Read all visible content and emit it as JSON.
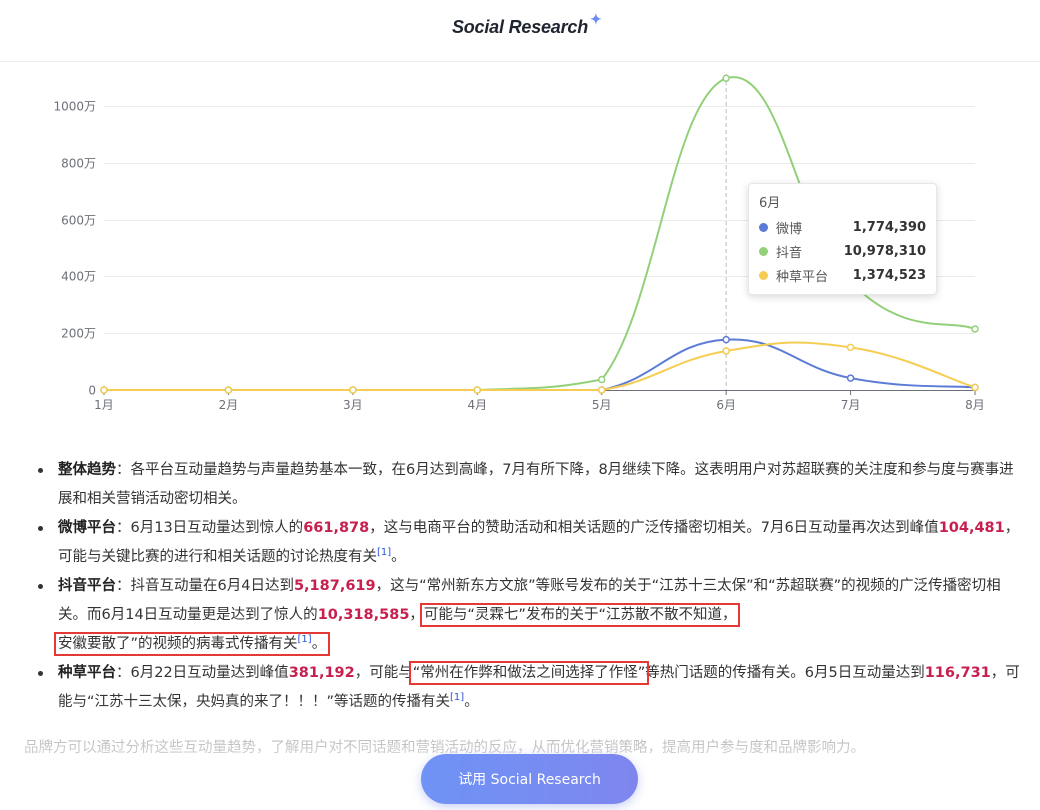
{
  "header": {
    "brand": "Social Research",
    "sparkle_icon": "sparkle-icon"
  },
  "chart_data": {
    "type": "line",
    "categories": [
      "1月",
      "2月",
      "3月",
      "4月",
      "5月",
      "6月",
      "7月",
      "8月"
    ],
    "y_ticks": [
      "0",
      "200万",
      "400万",
      "600万",
      "800万",
      "1000万"
    ],
    "ylim": [
      0,
      11000000
    ],
    "grid": true,
    "series": [
      {
        "name": "微博",
        "color": "#5b7bd6",
        "values": [
          0,
          0,
          0,
          0,
          0,
          1774390,
          420000,
          90000
        ]
      },
      {
        "name": "抖音",
        "color": "#93d07a",
        "values": [
          0,
          0,
          0,
          0,
          370000,
          10978310,
          3800000,
          2150000
        ]
      },
      {
        "name": "种草平台",
        "color": "#f5cd52",
        "values": [
          0,
          0,
          0,
          0,
          0,
          1374523,
          1500000,
          90000
        ]
      }
    ],
    "tooltip": {
      "title": "6月",
      "rows": [
        {
          "name": "微博",
          "value": "1,774,390",
          "color": "#5b7bd6"
        },
        {
          "name": "抖音",
          "value": "10,978,310",
          "color": "#93d07a"
        },
        {
          "name": "种草平台",
          "value": "1,374,523",
          "color": "#f5cd52"
        }
      ]
    }
  },
  "content": {
    "items": [
      {
        "term": "整体趋势",
        "text": "：各平台互动量趋势与声量趋势基本一致，在6月达到高峰，7月有所下降，8月继续下降。这表明用户对苏超联赛的关注度和参与度与赛事进展和相关营销活动密切相关。"
      },
      {
        "term": "微博平台",
        "t1": "：6月13日互动量达到惊人的",
        "n1": "661,878",
        "t2": "，这与电商平台的赞助活动和相关话题的广泛传播密切相关。7月6日互动量再次达到峰值",
        "n2": "104,481",
        "t3": "，可能与关键比赛的进行和相关话题的讨论热度有关",
        "ref": "[1]",
        "t4": "。"
      },
      {
        "term": "抖音平台",
        "t1": "：抖音互动量在6月4日达到",
        "n1": "5,187,619",
        "t2": "，这与“常州新东方文旅”等账号发布的关于“江苏十三太保”和“苏超联赛”的视频的广泛传播密切相关。而6月14日互动量更是达到了惊人的",
        "n2": "10,318,585",
        "t3": "，",
        "hl1": "可能与“灵霖七”发布的关于“江苏散不散不知道，",
        "hl2": "安徽要散了”的视频的病毒式传播有关",
        "ref": "[1]",
        "t4": "。"
      },
      {
        "term": "种草平台",
        "t1": "：6月22日互动量达到峰值",
        "n1": "381,192",
        "t2": "，可能与",
        "hl": "“常州在作弊和做法之间选择了作怪”",
        "t3": "等热门话题的传播有关。6月5日互动量达到",
        "n2": "116,731",
        "t4": "，可能与“江苏十三太保，央妈真的来了！！！”等话题的传播有关",
        "ref": "[1]",
        "t5": "。"
      }
    ],
    "footer": "品牌方可以通过分析这些互动量趋势，了解用户对不同话题和营销活动的反应，从而优化营销策略，提高用户参与度和品牌影响力。"
  },
  "cta": {
    "label": "试用 Social Research"
  }
}
